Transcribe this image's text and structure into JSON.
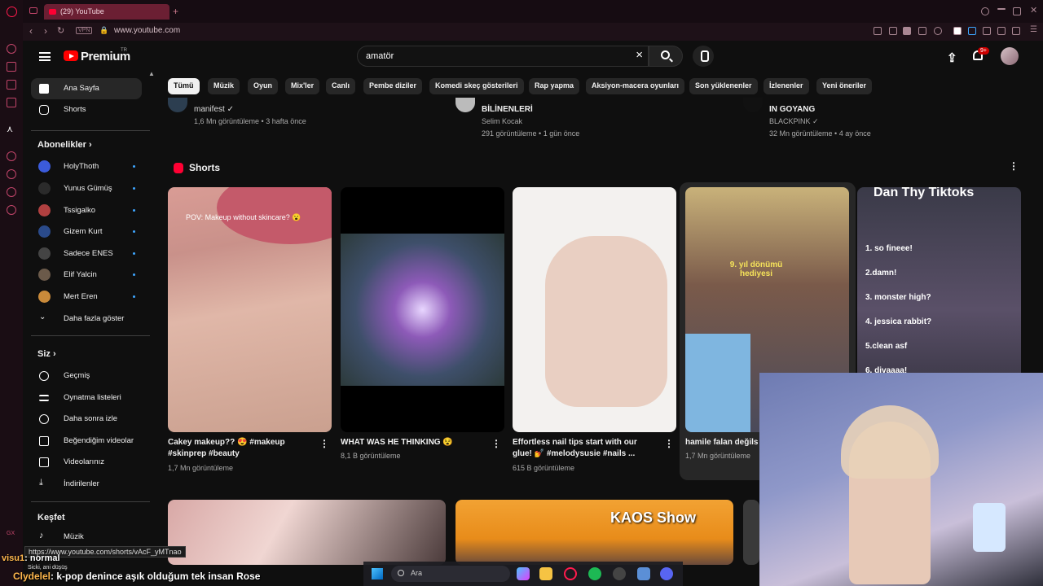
{
  "browser": {
    "tab_title": "(29) YouTube",
    "new_tab_symbol": "+",
    "vpn_label": "VPN",
    "url": "www.youtube.com"
  },
  "header": {
    "brand": "Premium",
    "country_code": "TR",
    "search_value": "amatör",
    "notification_badge": "9+"
  },
  "sidebar": {
    "main": [
      {
        "label": "Ana Sayfa",
        "icon": "home-icon"
      },
      {
        "label": "Shorts",
        "icon": "shorts-icon"
      }
    ],
    "subscriptions_heading": "Abonelikler",
    "subscriptions": [
      {
        "label": "HolyThoth",
        "color": "#3b5bdb"
      },
      {
        "label": "Yunus Gümüş",
        "color": "#2b2b2b"
      },
      {
        "label": "Tssigalko",
        "color": "#b04040"
      },
      {
        "label": "Gizem Kurt",
        "color": "#2a4a8a"
      },
      {
        "label": "Sadece ENES",
        "color": "#444"
      },
      {
        "label": "Elif Yalcin",
        "color": "#6b5a4a"
      },
      {
        "label": "Mert Eren",
        "color": "#c98a3a"
      }
    ],
    "show_more": "Daha fazla göster",
    "you_heading": "Siz",
    "you_items": [
      {
        "label": "Geçmiş",
        "icon": "history-icon"
      },
      {
        "label": "Oynatma listeleri",
        "icon": "playlist-icon"
      },
      {
        "label": "Daha sonra izle",
        "icon": "clock-icon"
      },
      {
        "label": "Beğendiğim videolar",
        "icon": "thumbs-up-icon"
      },
      {
        "label": "Videolarınız",
        "icon": "video-icon"
      },
      {
        "label": "İndirilenler",
        "icon": "download-icon"
      }
    ],
    "explore_heading": "Keşfet",
    "explore_items": [
      {
        "label": "Müzik",
        "icon": "music-icon"
      }
    ]
  },
  "chips": [
    "Tümü",
    "Müzik",
    "Oyun",
    "Mix'ler",
    "Canlı",
    "Pembe diziler",
    "Komedi skeç gösterileri",
    "Rap yapma",
    "Aksiyon-macera oyunları",
    "Son yüklenenler",
    "İzlenenler",
    "Yeni öneriler"
  ],
  "upper_videos": [
    {
      "title": "",
      "channel": "manifest",
      "meta": "1,6 Mn görüntüleme • 3 hafta önce"
    },
    {
      "title": "BİLİNENLERİ",
      "channel": "Selim Kocak",
      "meta": "291 görüntüleme • 1 gün önce"
    },
    {
      "title": "IN GOYANG",
      "channel": "BLACKPINK",
      "meta": "32 Mn görüntüleme • 4 ay önce"
    }
  ],
  "shorts_heading": "Shorts",
  "shorts": [
    {
      "title": "Cakey makeup?? 😍 #makeup #skinprep #beauty",
      "views": "1,7 Mn görüntüleme",
      "overlay": "POV: Makeup without skincare? 😮"
    },
    {
      "title": "WHAT WAS HE THINKING 😵",
      "views": "8,1 B görüntüleme",
      "overlay": ""
    },
    {
      "title": "Effortless nail tips start with our glue! 💅 #melodysusie #nails ...",
      "views": "615 B görüntüleme",
      "overlay": ""
    },
    {
      "title": "hamile falan değils",
      "views": "1,7 Mn görüntüleme",
      "overlay": "9. yıl dönümü hediyesi"
    },
    {
      "title": "",
      "views": "",
      "overlay": "Dan Thy Tiktoks"
    }
  ],
  "tiktok_list": [
    "1. so fineee!",
    "2.damn!",
    "3. monster high?",
    "4. jessica rabbit?",
    "5.clean asf",
    "6. divaaaa!"
  ],
  "lower_overlay": "KAOS Show",
  "status_url": "https://www.youtube.com/shorts/vAcF_yMTnao",
  "chat": [
    {
      "user": "visu1",
      "message": ": normal"
    },
    {
      "user": "Clydelel",
      "message": ": k-pop denince aşık olduğum tek insan Rose"
    }
  ],
  "chat_small": "Sicki, ani düşüş",
  "taskbar": {
    "search_label": "Ara"
  },
  "colors": {
    "accent": "#ff0033",
    "background": "#0f0f0f",
    "chip": "#272727"
  }
}
